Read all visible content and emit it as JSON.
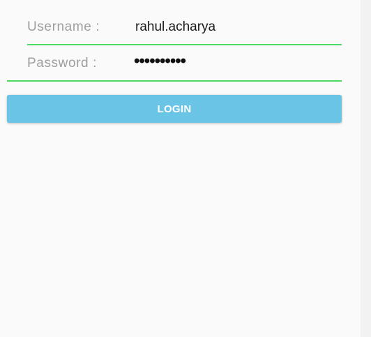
{
  "theme": {
    "background": "#fafafa",
    "field_underline_color": "#4cd964",
    "label_color": "#9e9e9e",
    "value_color": "#1a1a1a",
    "button_color": "#69c4e6",
    "button_text_color": "#ffffff"
  },
  "login_form": {
    "username": {
      "label": "Username :",
      "value": "rahul.acharya"
    },
    "password": {
      "label": "Password :",
      "value_masked": "••••••••••"
    },
    "login_button": {
      "label": "LOGIN"
    }
  }
}
